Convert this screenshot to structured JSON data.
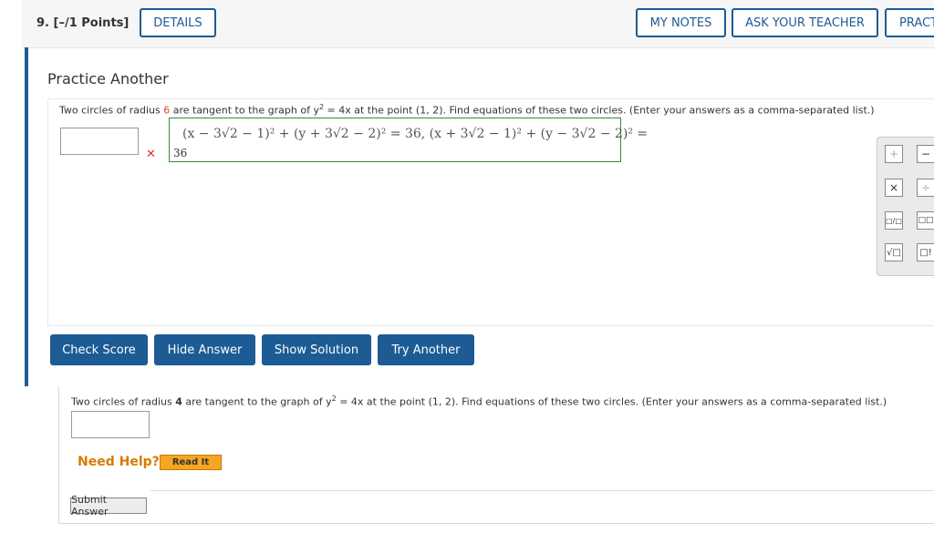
{
  "header": {
    "question_label": "9. [–/1 Points]",
    "details": "DETAILS",
    "my_notes": "MY NOTES",
    "ask_teacher": "ASK YOUR TEACHER",
    "practice": "PRACT"
  },
  "practice": {
    "title": "Practice Another",
    "prompt_before_radius": "Two circles of radius ",
    "radius": "6",
    "prompt_mid": " are tangent to the graph of y",
    "prompt_exp": "2",
    "prompt_after": " = 4x  at the point  (1, 2).  Find equations of these two circles. (Enter your answers as a comma-separated list.)",
    "wrong_mark": "✕",
    "math_preview": "(x − 3√2 − 1)² + (y + 3√2 − 2)² = 36, (x + 3√2 − 1)² + (y − 3√2 − 2)² =",
    "math_continued": "36"
  },
  "palette": {
    "plus": "+",
    "minus": "−",
    "times": "×",
    "divide": "÷",
    "fraction": "□/□",
    "power": "□□",
    "sqrt": "√□",
    "factorial": "□!"
  },
  "buttons": {
    "check_score": "Check Score",
    "hide_answer": "Hide Answer",
    "show_solution": "Show Solution",
    "try_another": "Try Another"
  },
  "question": {
    "prompt_before": "Two circles of radius ",
    "radius": "4",
    "prompt_mid": " are tangent to the graph of y",
    "prompt_exp": "2",
    "prompt_after": " = 4x at the point (1, 2). Find equations of these two circles. (Enter your answers as a comma-separated list.)",
    "answer_value": ""
  },
  "help": {
    "need_help": "Need Help?",
    "read_it": "Read It",
    "submit": "Submit Answer"
  },
  "colors": {
    "brand_blue": "#1d5b94",
    "error_red": "#d9342b",
    "help_orange": "#d97a00"
  }
}
